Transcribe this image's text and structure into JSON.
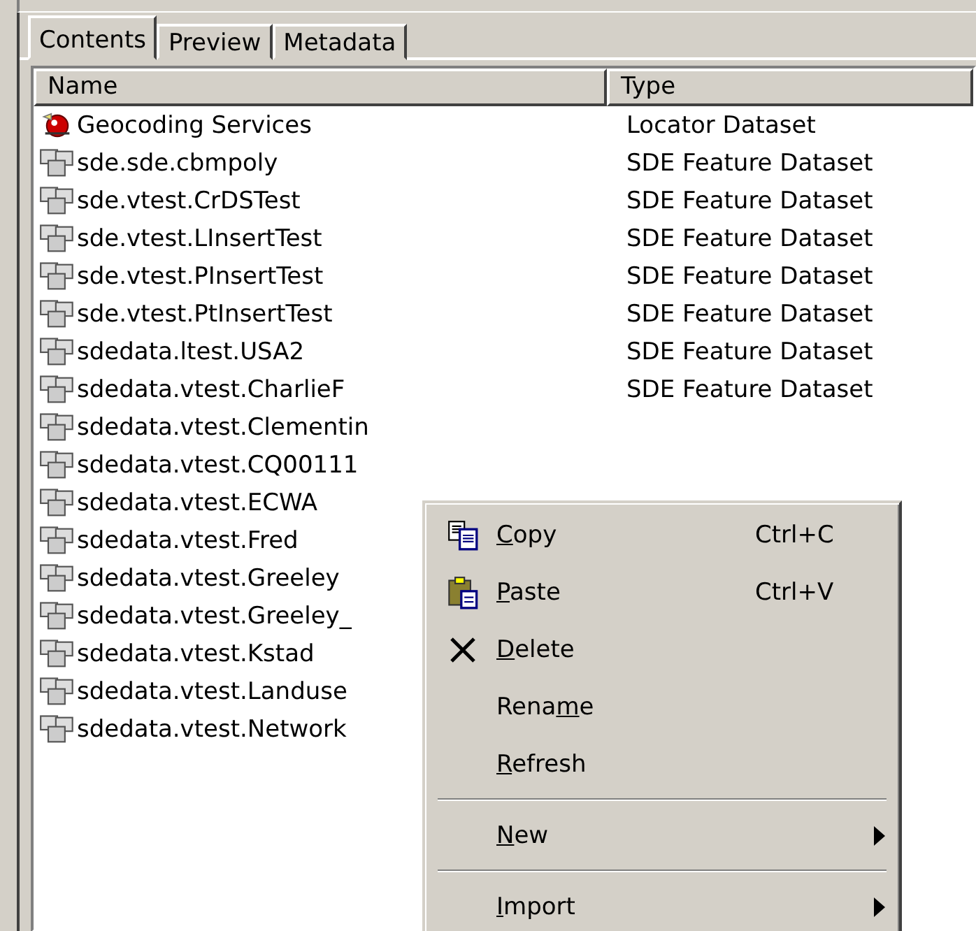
{
  "tabs": [
    {
      "label": "Contents",
      "selected": true
    },
    {
      "label": "Preview",
      "selected": false
    },
    {
      "label": "Metadata",
      "selected": false
    }
  ],
  "table": {
    "columns": [
      "Name",
      "Type"
    ],
    "rows": [
      {
        "kind": "locator",
        "name": "Geocoding Services",
        "type": "Locator Dataset"
      },
      {
        "kind": "feature_dataset",
        "name": "sde.sde.cbmpoly",
        "type": "SDE Feature Dataset"
      },
      {
        "kind": "feature_dataset",
        "name": "sde.vtest.CrDSTest",
        "type": "SDE Feature Dataset"
      },
      {
        "kind": "feature_dataset",
        "name": "sde.vtest.LInsertTest",
        "type": "SDE Feature Dataset"
      },
      {
        "kind": "feature_dataset",
        "name": "sde.vtest.PInsertTest",
        "type": "SDE Feature Dataset"
      },
      {
        "kind": "feature_dataset",
        "name": "sde.vtest.PtInsertTest",
        "type": "SDE Feature Dataset"
      },
      {
        "kind": "feature_dataset",
        "name": "sdedata.ltest.USA2",
        "type": "SDE Feature Dataset"
      },
      {
        "kind": "feature_dataset",
        "name": "sdedata.vtest.CharlieF",
        "type": "SDE Feature Dataset"
      },
      {
        "kind": "feature_dataset",
        "name": "sdedata.vtest.Clementin"
      },
      {
        "kind": "feature_dataset",
        "name": "sdedata.vtest.CQ00111"
      },
      {
        "kind": "feature_dataset",
        "name": "sdedata.vtest.ECWA"
      },
      {
        "kind": "feature_dataset",
        "name": "sdedata.vtest.Fred"
      },
      {
        "kind": "feature_dataset",
        "name": "sdedata.vtest.Greeley"
      },
      {
        "kind": "feature_dataset",
        "name": "sdedata.vtest.Greeley_"
      },
      {
        "kind": "feature_dataset",
        "name": "sdedata.vtest.Kstad"
      },
      {
        "kind": "feature_dataset",
        "name": "sdedata.vtest.Landuse"
      },
      {
        "kind": "feature_dataset",
        "name": "sdedata.vtest.Network"
      }
    ]
  },
  "context_menu": {
    "items": [
      {
        "kind": "copy",
        "label": {
          "key": "C",
          "after": "opy"
        },
        "shortcut": "Ctrl+C"
      },
      {
        "kind": "paste",
        "label": {
          "key": "P",
          "after": "aste"
        },
        "shortcut": "Ctrl+V"
      },
      {
        "kind": "delete",
        "label": {
          "key": "D",
          "after": "elete"
        }
      },
      {
        "kind": "plain",
        "label": {
          "before": "Rena",
          "key": "m",
          "after": "e"
        }
      },
      {
        "kind": "plain",
        "label": {
          "key": "R",
          "after": "efresh"
        }
      },
      {
        "kind": "separator"
      },
      {
        "kind": "submenu",
        "label": {
          "key": "N",
          "after": "ew"
        }
      },
      {
        "kind": "separator"
      },
      {
        "kind": "submenu",
        "label": {
          "key": "I",
          "after": "mport"
        }
      }
    ]
  }
}
